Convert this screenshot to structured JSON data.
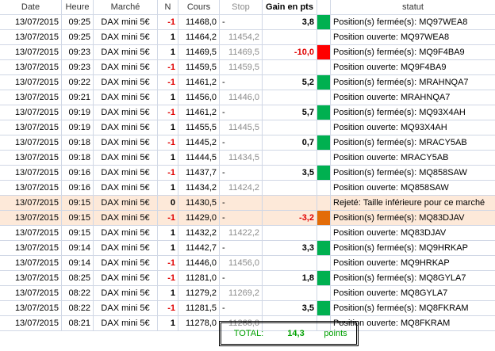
{
  "headers": {
    "date": "Date",
    "heure": "Heure",
    "marche": "Marché",
    "n": "N",
    "cours": "Cours",
    "stop": "Stop",
    "gain": "Gain en pts",
    "statut": "statut"
  },
  "colors": {
    "win": "#00b050",
    "loss": "#ff0000",
    "neutral": "#e36c09",
    "rejected_row": "#fde9d9"
  },
  "rows": [
    {
      "date": "13/07/2015",
      "heure": "09:25",
      "marche": "DAX mini 5€",
      "n": "-1",
      "cours": "11468,0",
      "stop": "-",
      "gain": "3,8",
      "status_color": "win",
      "statut": "Position(s) fermée(s): MQ97WEA8",
      "rejected": false
    },
    {
      "date": "13/07/2015",
      "heure": "09:25",
      "marche": "DAX mini 5€",
      "n": "1",
      "cours": "11464,2",
      "stop": "11454,2",
      "gain": "",
      "status_color": "",
      "statut": "Position ouverte: MQ97WEA8",
      "rejected": false
    },
    {
      "date": "13/07/2015",
      "heure": "09:23",
      "marche": "DAX mini 5€",
      "n": "1",
      "cours": "11469,5",
      "stop": "11469,5",
      "gain": "-10,0",
      "status_color": "loss",
      "statut": "Position(s) fermée(s): MQ9F4BA9",
      "rejected": false
    },
    {
      "date": "13/07/2015",
      "heure": "09:23",
      "marche": "DAX mini 5€",
      "n": "-1",
      "cours": "11459,5",
      "stop": "11459,5",
      "gain": "",
      "status_color": "",
      "statut": "Position ouverte: MQ9F4BA9",
      "rejected": false
    },
    {
      "date": "13/07/2015",
      "heure": "09:22",
      "marche": "DAX mini 5€",
      "n": "-1",
      "cours": "11461,2",
      "stop": "-",
      "gain": "5,2",
      "status_color": "win",
      "statut": "Position(s) fermée(s): MRAHNQA7",
      "rejected": false
    },
    {
      "date": "13/07/2015",
      "heure": "09:21",
      "marche": "DAX mini 5€",
      "n": "1",
      "cours": "11456,0",
      "stop": "11446,0",
      "gain": "",
      "status_color": "",
      "statut": "Position ouverte: MRAHNQA7",
      "rejected": false
    },
    {
      "date": "13/07/2015",
      "heure": "09:19",
      "marche": "DAX mini 5€",
      "n": "-1",
      "cours": "11461,2",
      "stop": "-",
      "gain": "5,7",
      "status_color": "win",
      "statut": "Position(s) fermée(s): MQ93X4AH",
      "rejected": false
    },
    {
      "date": "13/07/2015",
      "heure": "09:19",
      "marche": "DAX mini 5€",
      "n": "1",
      "cours": "11455,5",
      "stop": "11445,5",
      "gain": "",
      "status_color": "",
      "statut": "Position ouverte: MQ93X4AH",
      "rejected": false
    },
    {
      "date": "13/07/2015",
      "heure": "09:18",
      "marche": "DAX mini 5€",
      "n": "-1",
      "cours": "11445,2",
      "stop": "-",
      "gain": "0,7",
      "status_color": "win",
      "statut": "Position(s) fermée(s): MRACY5AB",
      "rejected": false
    },
    {
      "date": "13/07/2015",
      "heure": "09:18",
      "marche": "DAX mini 5€",
      "n": "1",
      "cours": "11444,5",
      "stop": "11434,5",
      "gain": "",
      "status_color": "",
      "statut": "Position ouverte: MRACY5AB",
      "rejected": false
    },
    {
      "date": "13/07/2015",
      "heure": "09:16",
      "marche": "DAX mini 5€",
      "n": "-1",
      "cours": "11437,7",
      "stop": "-",
      "gain": "3,5",
      "status_color": "win",
      "statut": "Position(s) fermée(s): MQ858SAW",
      "rejected": false
    },
    {
      "date": "13/07/2015",
      "heure": "09:16",
      "marche": "DAX mini 5€",
      "n": "1",
      "cours": "11434,2",
      "stop": "11424,2",
      "gain": "",
      "status_color": "",
      "statut": "Position ouverte: MQ858SAW",
      "rejected": false
    },
    {
      "date": "13/07/2015",
      "heure": "09:15",
      "marche": "DAX mini 5€",
      "n": "0",
      "cours": "11430,5",
      "stop": "-",
      "gain": "",
      "status_color": "",
      "statut": "Rejeté: Taille inférieure pour ce marché",
      "rejected": true
    },
    {
      "date": "13/07/2015",
      "heure": "09:15",
      "marche": "DAX mini 5€",
      "n": "-1",
      "cours": "11429,0",
      "stop": "-",
      "gain": "-3,2",
      "status_color": "neutral",
      "statut": "Position(s) fermée(s): MQ83DJAV",
      "rejected": true
    },
    {
      "date": "13/07/2015",
      "heure": "09:15",
      "marche": "DAX mini 5€",
      "n": "1",
      "cours": "11432,2",
      "stop": "11422,2",
      "gain": "",
      "status_color": "",
      "statut": "Position ouverte: MQ83DJAV",
      "rejected": false
    },
    {
      "date": "13/07/2015",
      "heure": "09:14",
      "marche": "DAX mini 5€",
      "n": "1",
      "cours": "11442,7",
      "stop": "-",
      "gain": "3,3",
      "status_color": "win",
      "statut": "Position(s) fermée(s): MQ9HRKAP",
      "rejected": false
    },
    {
      "date": "13/07/2015",
      "heure": "09:14",
      "marche": "DAX mini 5€",
      "n": "-1",
      "cours": "11446,0",
      "stop": "11456,0",
      "gain": "",
      "status_color": "",
      "statut": "Position ouverte: MQ9HRKAP",
      "rejected": false
    },
    {
      "date": "13/07/2015",
      "heure": "08:25",
      "marche": "DAX mini 5€",
      "n": "-1",
      "cours": "11281,0",
      "stop": "-",
      "gain": "1,8",
      "status_color": "win",
      "statut": "Position(s) fermée(s): MQ8GYLA7",
      "rejected": false
    },
    {
      "date": "13/07/2015",
      "heure": "08:22",
      "marche": "DAX mini 5€",
      "n": "1",
      "cours": "11279,2",
      "stop": "11269,2",
      "gain": "",
      "status_color": "",
      "statut": "Position ouverte: MQ8GYLA7",
      "rejected": false
    },
    {
      "date": "13/07/2015",
      "heure": "08:22",
      "marche": "DAX mini 5€",
      "n": "-1",
      "cours": "11281,5",
      "stop": "-",
      "gain": "3,5",
      "status_color": "win",
      "statut": "Position(s) fermée(s): MQ8FKRAM",
      "rejected": false
    },
    {
      "date": "13/07/2015",
      "heure": "08:21",
      "marche": "DAX mini 5€",
      "n": "1",
      "cours": "11278,0",
      "stop": "11268,0",
      "gain": "",
      "status_color": "",
      "statut": "Position ouverte: MQ8FKRAM",
      "rejected": false
    }
  ],
  "total": {
    "label": "TOTAL:",
    "value": "14,3",
    "unit": "points"
  }
}
